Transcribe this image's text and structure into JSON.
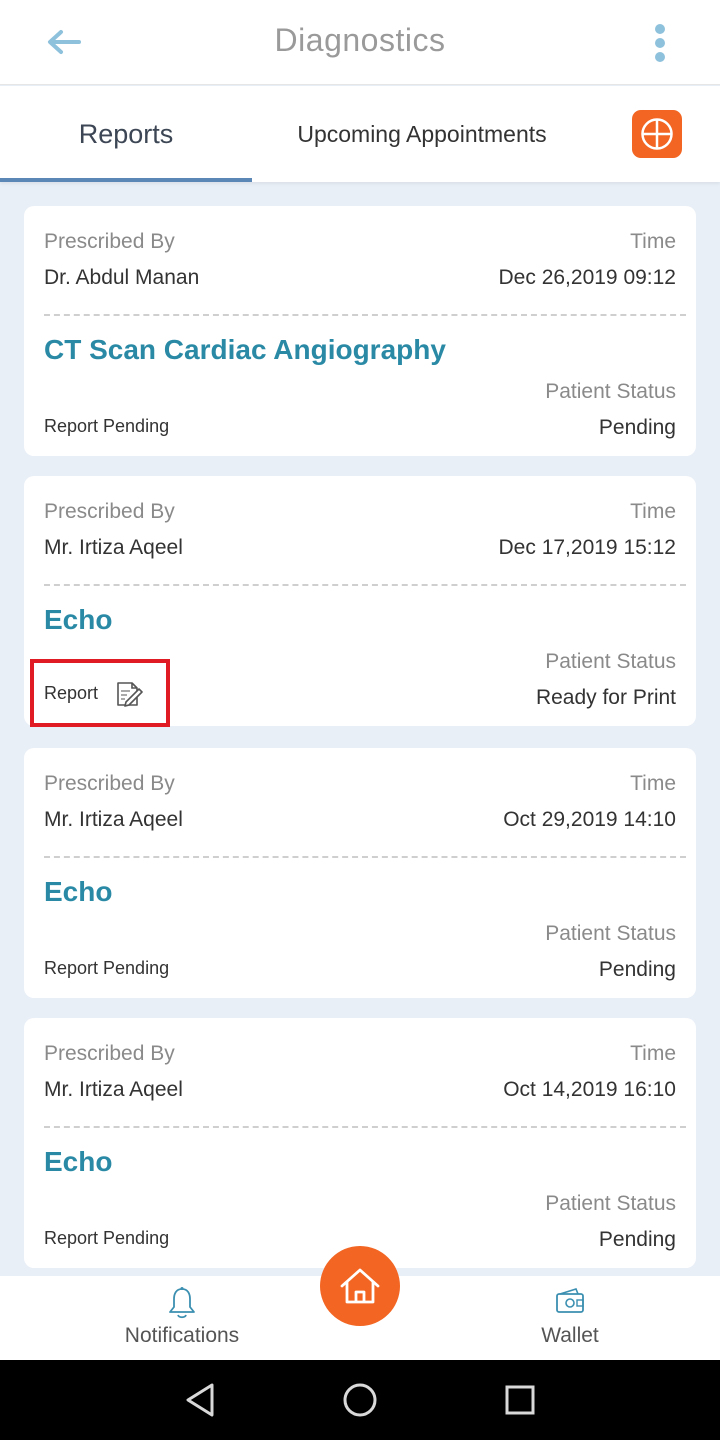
{
  "header": {
    "title": "Diagnostics",
    "back_icon": "arrow-left-icon",
    "more_icon": "more-vertical-icon"
  },
  "tabs": [
    {
      "label": "Reports",
      "active": true
    },
    {
      "label": "Upcoming Appointments",
      "active": false
    }
  ],
  "add_button": {
    "icon": "add-circle-icon",
    "color": "#f26522"
  },
  "labels": {
    "prescribed_by": "Prescribed By",
    "time": "Time",
    "patient_status": "Patient Status"
  },
  "cards": [
    {
      "doctor": "Dr. Abdul Manan",
      "datetime": "Dec 26,2019 09:12",
      "test": "CT Scan Cardiac Angiography",
      "report": "Report Pending",
      "status": "Pending"
    },
    {
      "doctor": "Mr. Irtiza Aqeel",
      "datetime": "Dec 17,2019 15:12",
      "test": "Echo",
      "report": "Report",
      "report_icon": "document-edit-icon",
      "status": "Ready for Print"
    },
    {
      "doctor": "Mr. Irtiza Aqeel",
      "datetime": "Oct 29,2019 14:10",
      "test": "Echo",
      "report": "Report Pending",
      "status": "Pending"
    },
    {
      "doctor": "Mr. Irtiza Aqeel",
      "datetime": "Oct 14,2019 16:10",
      "test": "Echo",
      "report": "Report Pending",
      "status": "Pending"
    }
  ],
  "bottom_nav": {
    "notifications": {
      "label": "Notifications",
      "icon": "bell-icon"
    },
    "home": {
      "icon": "home-icon",
      "color": "#f26522"
    },
    "wallet": {
      "label": "Wallet",
      "icon": "wallet-icon"
    }
  },
  "system_nav": {
    "back_icon": "triangle-back-icon",
    "home_icon": "circle-home-icon",
    "recents_icon": "square-recents-icon"
  },
  "colors": {
    "accent": "#2a8aa6",
    "tab_indicator": "#5b87b7",
    "background": "#e9eff7",
    "highlight_box": "#e01b24"
  }
}
